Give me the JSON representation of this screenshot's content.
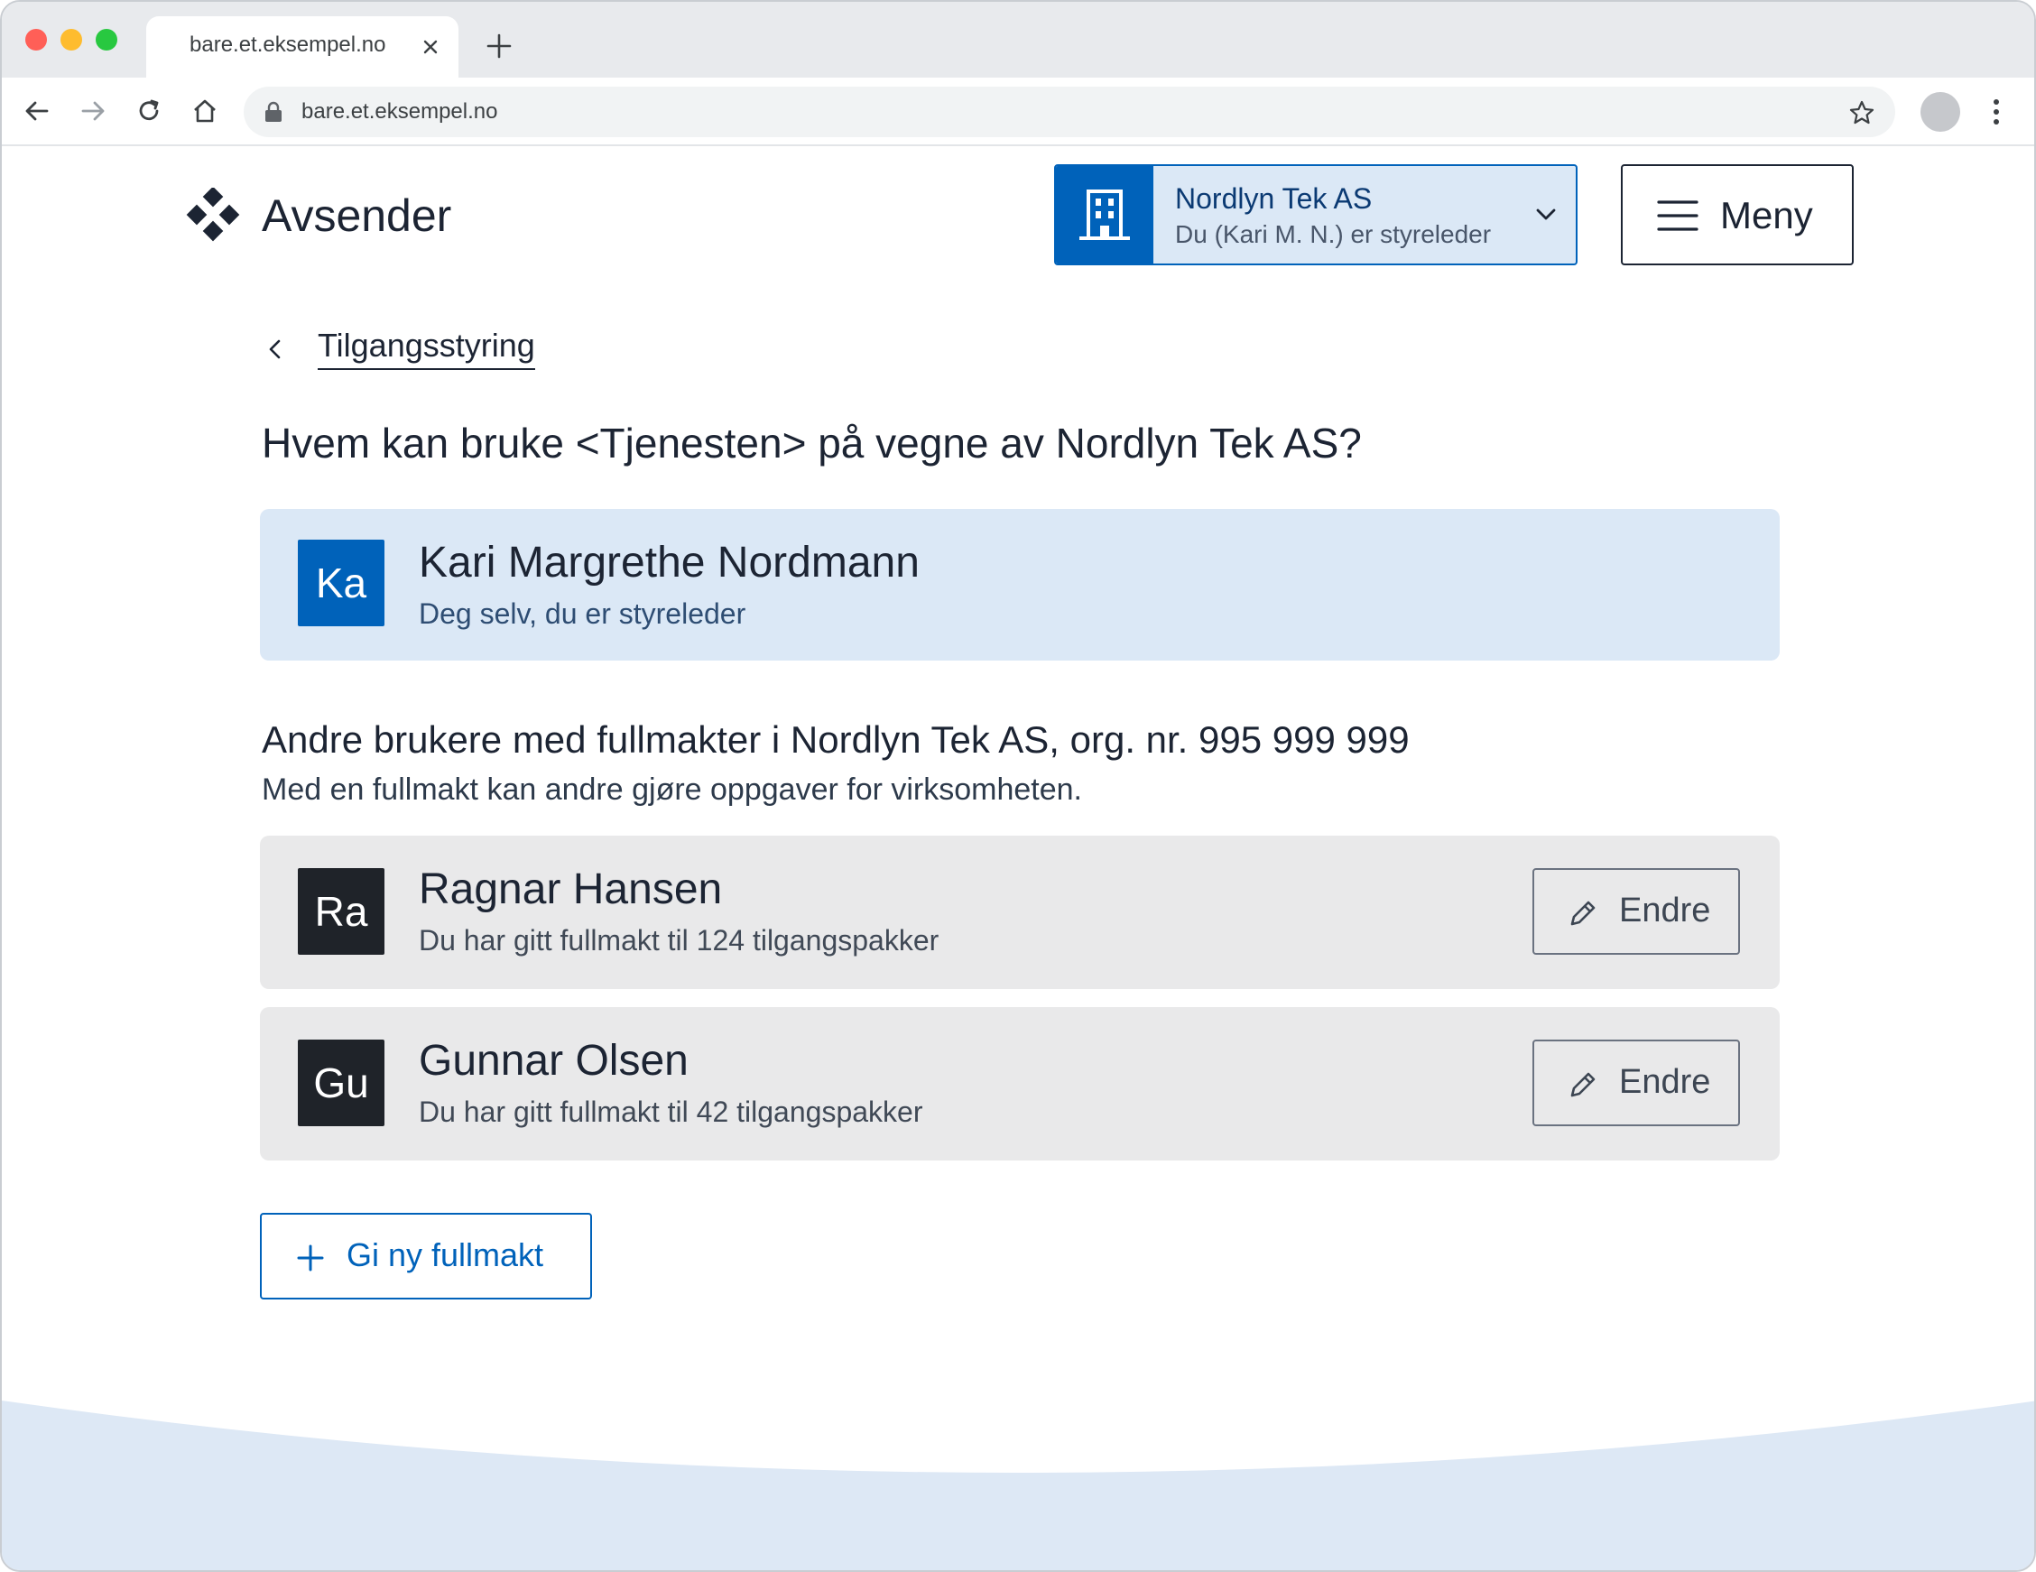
{
  "browser": {
    "tab_title": "bare.et.eksempel.no",
    "url": "bare.et.eksempel.no"
  },
  "header": {
    "brand": "Avsender",
    "account": {
      "name": "Nordlyn Tek AS",
      "role": "Du (Kari M. N.) er styreleder"
    },
    "menu_label": "Meny"
  },
  "breadcrumb": {
    "back_label": "Tilgangsstyring"
  },
  "main": {
    "title": "Hvem kan bruke <Tjenesten> på vegne av Nordlyn Tek AS?",
    "self": {
      "initials": "Ka",
      "name": "Kari Margrethe Nordmann",
      "description": "Deg selv, du er styreleder"
    },
    "others_heading": "Andre brukere med fullmakter i Nordlyn Tek AS, org. nr. 995 999 999",
    "others_description": "Med en fullmakt kan andre gjøre oppgaver for virksomheten.",
    "users": [
      {
        "initials": "Ra",
        "name": "Ragnar Hansen",
        "description": "Du har gitt fullmakt til 124 tilgangspakker",
        "edit_label": "Endre"
      },
      {
        "initials": "Gu",
        "name": "Gunnar Olsen",
        "description": "Du har gitt fullmakt til 42 tilgangspakker",
        "edit_label": "Endre"
      }
    ],
    "add_label": "Gi ny fullmakt"
  },
  "colors": {
    "primary": "#0062ba",
    "primary_light": "#dbe8f6",
    "neutral_card": "#e9e9ea",
    "text": "#1c2433"
  }
}
